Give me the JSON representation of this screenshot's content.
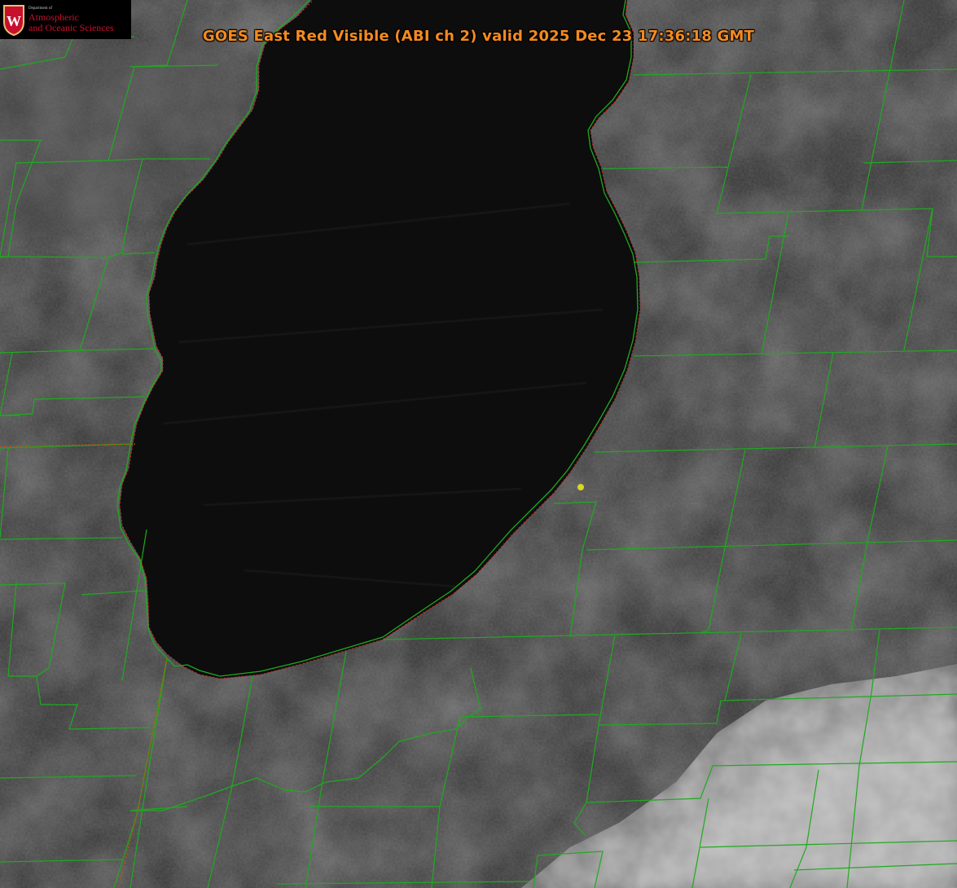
{
  "title": "GOES East Red Visible (ABI ch 2) valid 2025 Dec 23 17:36:18 GMT",
  "logo": {
    "department": "Department of",
    "line1": "Atmospheric",
    "line2": "and Oceanic Sciences",
    "crest_letter": "W"
  },
  "colors": {
    "title": "#f58a1f",
    "county_lines": "#1faa1f",
    "state_line": "#c85000",
    "shoreline_dotted": "#e02020",
    "station_dot": "#d8d820",
    "logo_red": "#c8102e"
  },
  "icons": [
    "uw-crest-icon",
    "station-marker-icon"
  ]
}
